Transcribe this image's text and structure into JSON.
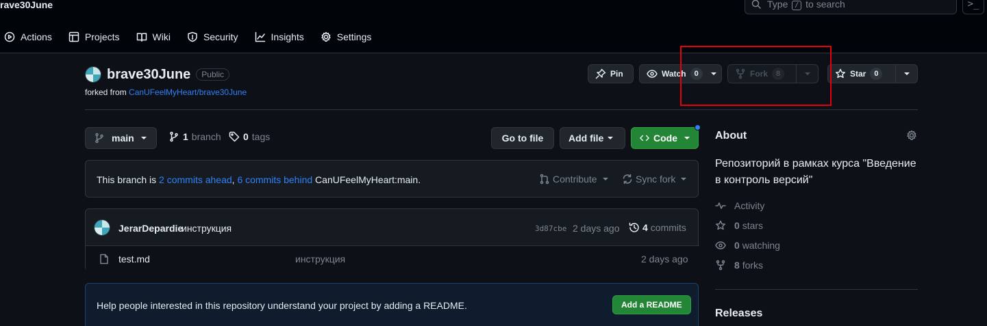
{
  "topbar": {
    "repo_crumb": "rave30June",
    "search_prefix": "Type",
    "search_key": "/",
    "search_suffix": "to search",
    "command_icon": ">_"
  },
  "tabs": [
    {
      "label": "Actions",
      "icon": "play-icon"
    },
    {
      "label": "Projects",
      "icon": "table-icon"
    },
    {
      "label": "Wiki",
      "icon": "book-icon"
    },
    {
      "label": "Security",
      "icon": "shield-icon"
    },
    {
      "label": "Insights",
      "icon": "graph-icon"
    },
    {
      "label": "Settings",
      "icon": "gear-icon"
    }
  ],
  "repo": {
    "name": "brave30June",
    "visibility": "Public",
    "forked_prefix": "forked from",
    "forked_source": "CanUFeelMyHeart/brave30June"
  },
  "header_buttons": {
    "pin": "Pin",
    "watch": "Watch",
    "watch_count": "0",
    "fork": "Fork",
    "fork_count": "8",
    "star": "Star",
    "star_count": "0"
  },
  "toolbar": {
    "branch": "main",
    "branch_count": "1",
    "branch_label": "branch",
    "tag_count": "0",
    "tag_label": "tags",
    "go_to_file": "Go to file",
    "add_file": "Add file",
    "code": "Code"
  },
  "branch_status": {
    "prefix": "This branch is",
    "ahead": "2 commits ahead",
    "sep": ",",
    "behind": "6 commits behind",
    "target": "CanUFeelMyHeart:main.",
    "contribute": "Contribute",
    "sync_fork": "Sync fork"
  },
  "latest_commit": {
    "author": "JerarDepardie",
    "message": "инструкция",
    "sha": "3d87cbe",
    "time": "2 days ago",
    "commit_count": "4",
    "commit_label": "commits"
  },
  "files": [
    {
      "name": "test.md",
      "message": "инструкция",
      "time": "2 days ago"
    }
  ],
  "readme_prompt": {
    "text": "Help people interested in this repository understand your project by adding a README.",
    "button": "Add a README"
  },
  "about": {
    "title": "About",
    "description": "Репозиторий в рамках курса \"Введение в контроль версий\"",
    "activity": "Activity",
    "stars_count": "0",
    "stars_label": "stars",
    "watching_count": "0",
    "watching_label": "watching",
    "forks_count": "8",
    "forks_label": "forks",
    "releases": "Releases"
  },
  "colors": {
    "accent_blue": "#2f81f7",
    "green_button": "#238636",
    "highlight_box": "#e5000d",
    "background": "#0d1117"
  }
}
